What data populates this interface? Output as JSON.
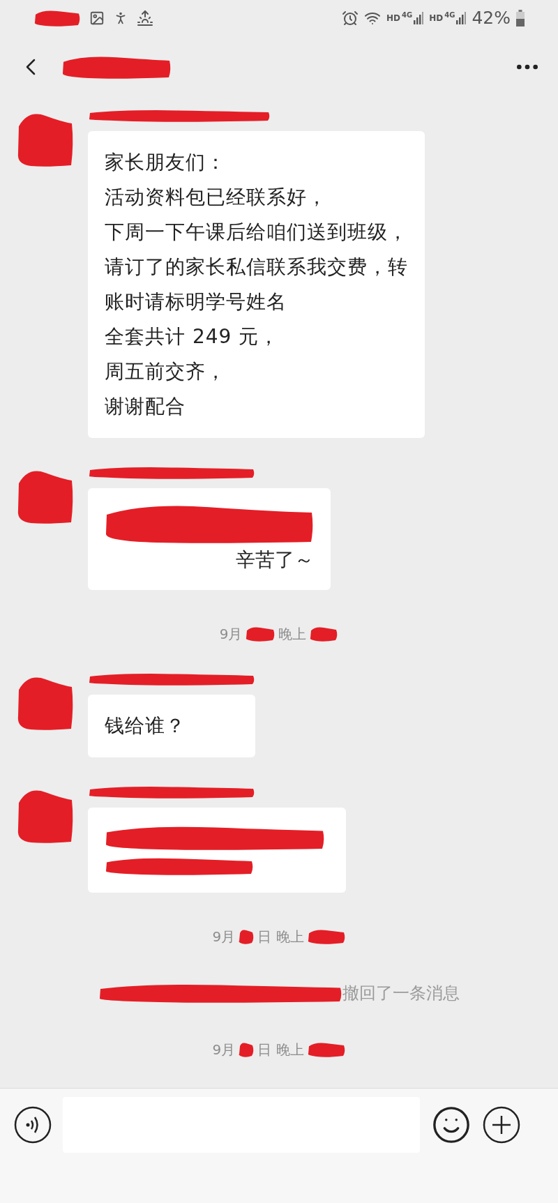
{
  "status_bar": {
    "networks": [
      {
        "hd": "HD",
        "gen": "4G"
      },
      {
        "hd": "HD",
        "gen": "4G"
      }
    ],
    "battery": "42%"
  },
  "messages": [
    {
      "kind": "text",
      "lines": [
        "家长朋友们：",
        "活动资料包已经联系好，",
        "下周一下午课后给咱们送到班级，",
        "请订了的家长私信联系我交费，转",
        "账时请标明学号姓名",
        "全套共计 249 元，",
        "周五前交齐，",
        "谢谢配合"
      ]
    },
    {
      "kind": "redacted_text",
      "lines": [
        "辛苦了～"
      ]
    },
    {
      "kind": "timestamp",
      "parts": [
        "9月",
        "晚上"
      ]
    },
    {
      "kind": "text",
      "lines": [
        "钱给谁？"
      ]
    },
    {
      "kind": "redacted"
    },
    {
      "kind": "timestamp",
      "parts": [
        "9月",
        "日 晚上"
      ]
    },
    {
      "kind": "recall",
      "lines": [
        "撤回了一条消息"
      ]
    },
    {
      "kind": "timestamp",
      "parts": [
        "9月",
        "日 晚上"
      ]
    }
  ]
}
